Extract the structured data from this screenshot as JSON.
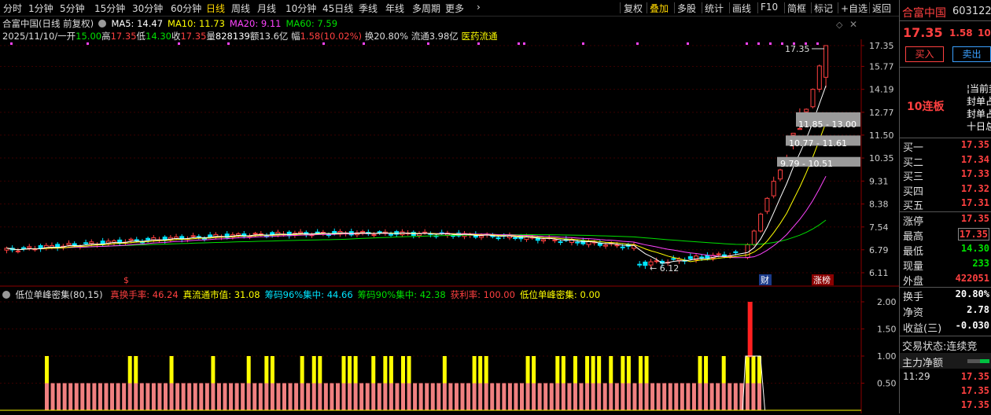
{
  "toolbar": {
    "periods": [
      "分时",
      "1分钟",
      "5分钟",
      "15分钟",
      "30分钟",
      "60分钟",
      "日线",
      "周线",
      "月线",
      "10分钟",
      "45日线",
      "季线",
      "年线",
      "多周期",
      "更多"
    ],
    "active_period": "日线",
    "buttons": [
      "复权",
      "叠加",
      "多股",
      "统计",
      "画线",
      "F10",
      "简框",
      "标记",
      "+自选",
      "返回"
    ],
    "active_button": "叠加"
  },
  "chart_header": {
    "title": "合富中国(日线 前复权)",
    "ma": [
      {
        "label": "MA5: 14.47",
        "color": "#ffffff"
      },
      {
        "label": "MA10: 11.73",
        "color": "#ffff00"
      },
      {
        "label": "MA20: 9.11",
        "color": "#ff44ff"
      },
      {
        "label": "MA60: 7.59",
        "color": "#00e000"
      }
    ],
    "date": "2025/11/10/一",
    "open_label": "开",
    "open": "15.00",
    "high_label": "高",
    "high": "17.35",
    "low_label": "低",
    "low": "14.30",
    "close_label": "收",
    "close": "17.35",
    "vol_label": "量",
    "vol": "828139",
    "amt_label": "额",
    "amt": "13.6亿",
    "chg_label": "幅",
    "chg": "1.58(10.02%)",
    "turnover_label": "换",
    "turnover": "20.80%",
    "float_label": "流通",
    "float": "3.98亿",
    "sector": "医药流通"
  },
  "price_axis": [
    "17.35",
    "15.77",
    "14.19",
    "12.77",
    "11.50",
    "10.35",
    "9.31",
    "8.38",
    "7.54",
    "6.79",
    "6.11"
  ],
  "chart_annotations": {
    "high_marker": "17.35",
    "low_marker": "6.12",
    "zone1": "11.85 - 13.00",
    "zone2": "10.77 - 11.61",
    "zone3": "9.79 - 10.51",
    "tag_cai": "财",
    "tag_zhangbang": "涨榜",
    "tag_s": "$"
  },
  "indicator": {
    "name": "低位单峰密集(80,15)",
    "items": [
      {
        "label": "真换手率: 46.24",
        "color": "#ff4040"
      },
      {
        "label": "真流通市值: 31.08",
        "color": "#ffff00"
      },
      {
        "label": "筹码96%集中: 44.66",
        "color": "#00e5ff"
      },
      {
        "label": "筹码90%集中: 42.38",
        "color": "#00e000"
      },
      {
        "label": "获利率: 100.00",
        "color": "#ff4040"
      },
      {
        "label": "低位单峰密集: 0.00",
        "color": "#ffff00"
      }
    ],
    "axis": [
      "2.00",
      "1.50",
      "1.00",
      "0.50"
    ]
  },
  "right_panel": {
    "name": "合富中国",
    "code": "603122",
    "price": "17.35",
    "change": "1.58",
    "pct": "10",
    "buy_btn": "买入",
    "sell_btn": "卖出",
    "streak": "10连板",
    "notes": [
      "当前封",
      "封单占",
      "封单占",
      "十日总"
    ],
    "bids": [
      {
        "label": "买一",
        "value": "17.35"
      },
      {
        "label": "买二",
        "value": "17.34"
      },
      {
        "label": "买三",
        "value": "17.33"
      },
      {
        "label": "买四",
        "value": "17.32"
      },
      {
        "label": "买五",
        "value": "17.31"
      }
    ],
    "stats": [
      {
        "label": "涨停",
        "value": "17.35",
        "color": "#ff4040"
      },
      {
        "label": "最高",
        "value": "17.35",
        "color": "#ff4040"
      },
      {
        "label": "最低",
        "value": "14.30",
        "color": "#00e000"
      },
      {
        "label": "现量",
        "value": "233",
        "color": "#00e000"
      },
      {
        "label": "外盘",
        "value": "422051",
        "color": "#ff4040"
      }
    ],
    "stats2": [
      {
        "label": "换手",
        "value": "20.80%",
        "color": "#ffffff"
      },
      {
        "label": "净资",
        "value": "2.78",
        "color": "#ffffff"
      },
      {
        "label": "收益(三)",
        "value": "-0.030",
        "color": "#ffffff"
      }
    ],
    "trade_state_label": "交易状态:",
    "trade_state": "连续竞",
    "main_flow": "主力净额",
    "ticks": [
      {
        "time": "11:29",
        "value": "17.35"
      },
      {
        "time": "",
        "value": "17.35"
      },
      {
        "time": "",
        "value": "17.35"
      }
    ]
  },
  "colors": {
    "up": "#ff4040",
    "down": "#00e5ff",
    "ma5": "#ffffff",
    "ma10": "#ffff00",
    "ma20": "#ff44ff",
    "ma60": "#00e000",
    "bar_base": "#f08080",
    "bar_top": "#ffff00"
  }
}
